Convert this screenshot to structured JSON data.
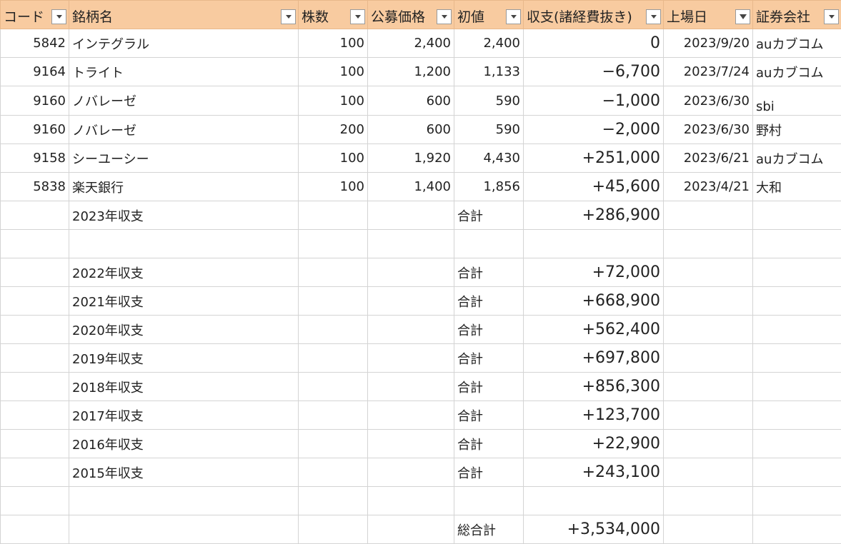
{
  "headers": [
    "コード",
    "銘柄名",
    "株数",
    "公募価格",
    "初値",
    "収支(諸経費抜き)",
    "上場日",
    "証券会社"
  ],
  "rows": [
    {
      "code": "5842",
      "name": "インテグラル",
      "shares": "100",
      "price": "2,400",
      "initial": "2,400",
      "pl": "0",
      "date": "2023/9/20",
      "broker": "auカブコム"
    },
    {
      "code": "9164",
      "name": "トライト",
      "shares": "100",
      "price": "1,200",
      "initial": "1,133",
      "pl": "−6,700",
      "date": "2023/7/24",
      "broker": "auカブコム"
    },
    {
      "code": "9160",
      "name": "ノバレーゼ",
      "shares": "100",
      "price": "600",
      "initial": "590",
      "pl": "−1,000",
      "date": "2023/6/30",
      "broker": "sbi"
    },
    {
      "code": "9160",
      "name": "ノバレーゼ",
      "shares": "200",
      "price": "600",
      "initial": "590",
      "pl": "−2,000",
      "date": "2023/6/30",
      "broker": "野村"
    },
    {
      "code": "9158",
      "name": "シーユーシー",
      "shares": "100",
      "price": "1,920",
      "initial": "4,430",
      "pl": "+251,000",
      "date": "2023/6/21",
      "broker": "auカブコム"
    },
    {
      "code": "5838",
      "name": "楽天銀行",
      "shares": "100",
      "price": "1,400",
      "initial": "1,856",
      "pl": "+45,600",
      "date": "2023/4/21",
      "broker": "大和"
    }
  ],
  "summary_label": "合計",
  "year_2023": {
    "label": "2023年収支",
    "total": "+286,900"
  },
  "past_years": [
    {
      "label": "2022年収支",
      "total": "+72,000"
    },
    {
      "label": "2021年収支",
      "total": "+668,900"
    },
    {
      "label": "2020年収支",
      "total": "+562,400"
    },
    {
      "label": "2019年収支",
      "total": "+697,800"
    },
    {
      "label": "2018年収支",
      "total": "+856,300"
    },
    {
      "label": "2017年収支",
      "total": "+123,700"
    },
    {
      "label": "2016年収支",
      "total": "+22,900"
    },
    {
      "label": "2015年収支",
      "total": "+243,100"
    }
  ],
  "grand_total": {
    "label": "総合計",
    "total": "+3,534,000"
  },
  "colors": {
    "header_bg": "#f8cba0",
    "grid": "#d4d4d4"
  }
}
